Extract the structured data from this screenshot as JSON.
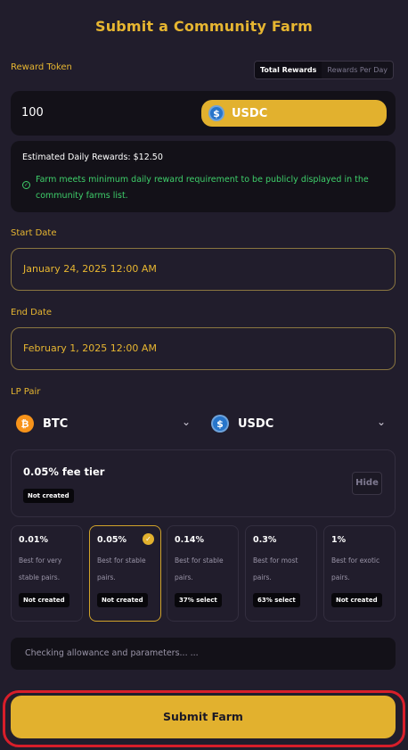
{
  "page": {
    "title": "Submit a Community Farm"
  },
  "reward": {
    "label": "Reward Token",
    "toggle": {
      "options": [
        "Total Rewards",
        "Rewards Per Day"
      ],
      "active": "Total Rewards"
    },
    "amount": "100",
    "token": "USDC",
    "estimated": "Estimated Daily Rewards: $12.50",
    "note": "Farm meets minimum daily reward requirement to be publicly displayed in the community farms list."
  },
  "start_date": {
    "label": "Start Date",
    "value": "January 24, 2025 12:00 AM"
  },
  "end_date": {
    "label": "End Date",
    "value": "February 1, 2025 12:00 AM"
  },
  "lp_pair": {
    "label": "LP Pair",
    "token_a": {
      "symbol": "BTC",
      "icon": "bitcoin-icon"
    },
    "token_b": {
      "symbol": "USDC",
      "icon": "usdc-icon"
    }
  },
  "fee_tier": {
    "title": "0.05% fee tier",
    "status": "Not created",
    "hide_label": "Hide",
    "options": [
      {
        "pct": "0.01%",
        "desc": "Best for very stable pairs.",
        "badge": "Not created"
      },
      {
        "pct": "0.05%",
        "desc": "Best for stable pairs.",
        "badge": "Not created",
        "selected": true
      },
      {
        "pct": "0.14%",
        "desc": "Best for stable pairs.",
        "badge": "37% select"
      },
      {
        "pct": "0.3%",
        "desc": "Best for most pairs.",
        "badge": "63% select"
      },
      {
        "pct": "1%",
        "desc": "Best for exotic pairs.",
        "badge": "Not created"
      }
    ]
  },
  "status": "Checking allowance and parameters...  ...",
  "submit_label": "Submit Farm",
  "colors": {
    "accent": "#e2b12e",
    "background": "#211d2c",
    "success": "#3ecf6a",
    "highlight": "#d81e2a"
  }
}
